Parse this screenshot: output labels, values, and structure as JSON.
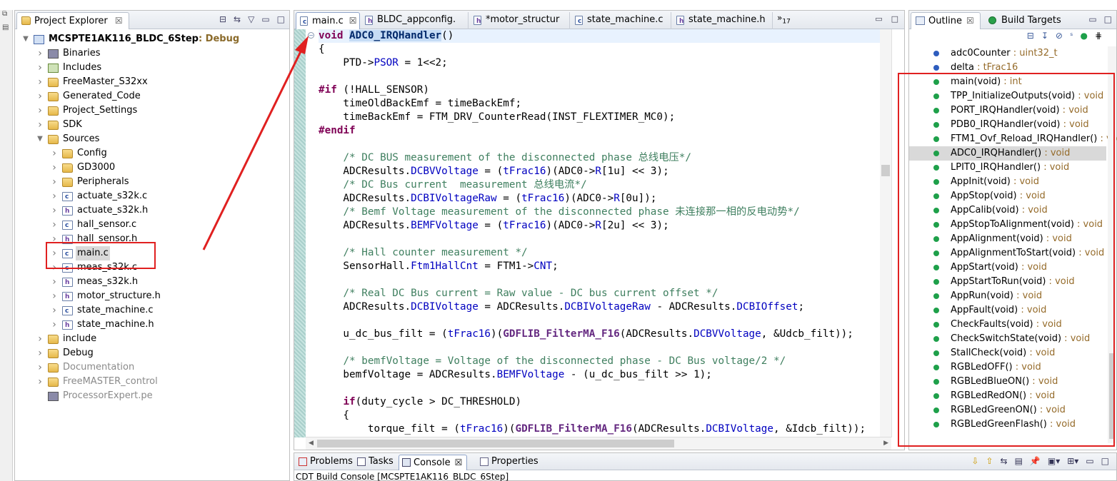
{
  "project_explorer": {
    "tab_label": "Project Explorer",
    "close_glyph": "☒",
    "project": {
      "name": "MCSPTE1AK116_BLDC_6Step",
      "config": ": Debug"
    },
    "items": [
      {
        "label": "Binaries"
      },
      {
        "label": "Includes"
      },
      {
        "label": "FreeMaster_S32xx"
      },
      {
        "label": "Generated_Code"
      },
      {
        "label": "Project_Settings"
      },
      {
        "label": "SDK"
      },
      {
        "label": "Sources"
      },
      {
        "label": "Config"
      },
      {
        "label": "GD3000"
      },
      {
        "label": "Peripherals"
      },
      {
        "label": "actuate_s32k.c"
      },
      {
        "label": "actuate_s32k.h"
      },
      {
        "label": "hall_sensor.c"
      },
      {
        "label": "hall_sensor.h"
      },
      {
        "label": "main.c"
      },
      {
        "label": "meas_s32k.c"
      },
      {
        "label": "meas_s32k.h"
      },
      {
        "label": "motor_structure.h"
      },
      {
        "label": "state_machine.c"
      },
      {
        "label": "state_machine.h"
      },
      {
        "label": "include"
      },
      {
        "label": "Debug"
      },
      {
        "label": "Documentation"
      },
      {
        "label": "FreeMASTER_control"
      },
      {
        "label": "ProcessorExpert.pe"
      }
    ]
  },
  "editor": {
    "tabs": [
      {
        "label": "main.c"
      },
      {
        "label": "BLDC_appconfig."
      },
      {
        "label": "*motor_structur"
      },
      {
        "label": "state_machine.c"
      },
      {
        "label": "state_machine.h"
      }
    ],
    "overflow": "»",
    "overflow_count": "17",
    "code_lines": [
      {
        "t": "void ADC0_IRQHandler()"
      },
      {
        "t": "{"
      },
      {
        "t": "    PTD->PSOR = 1<<2;"
      },
      {
        "t": ""
      },
      {
        "t": "#if (!HALL_SENSOR)"
      },
      {
        "t": "    timeOldBackEmf = timeBackEmf;"
      },
      {
        "t": "    timeBackEmf = FTM_DRV_CounterRead(INST_FLEXTIMER_MC0);"
      },
      {
        "t": "#endif"
      },
      {
        "t": ""
      },
      {
        "t": "    /* DC BUS measurement of the disconnected phase 总线电压*/"
      },
      {
        "t": "    ADCResults.DCBVVoltage = (tFrac16)(ADC0->R[1u] << 3);"
      },
      {
        "t": "    /* DC Bus current  measurement 总线电流*/"
      },
      {
        "t": "    ADCResults.DCBIVoltageRaw = (tFrac16)(ADC0->R[0u]);"
      },
      {
        "t": "    /* Bemf Voltage measurement of the disconnected phase 未连接那一相的反电动势*/"
      },
      {
        "t": "    ADCResults.BEMFVoltage = (tFrac16)(ADC0->R[2u] << 3);"
      },
      {
        "t": ""
      },
      {
        "t": "    /* Hall counter measurement */"
      },
      {
        "t": "    SensorHall.Ftm1HallCnt = FTM1->CNT;"
      },
      {
        "t": ""
      },
      {
        "t": "    /* Real DC Bus current = Raw value - DC bus current offset */"
      },
      {
        "t": "    ADCResults.DCBIVoltage = ADCResults.DCBIVoltageRaw - ADCResults.DCBIOffset;"
      },
      {
        "t": ""
      },
      {
        "t": "    u_dc_bus_filt = (tFrac16)(GDFLIB_FilterMA_F16(ADCResults.DCBVVoltage, &Udcb_filt));"
      },
      {
        "t": ""
      },
      {
        "t": "    /* bemfVoltage = Voltage of the disconnected phase - DC Bus voltage/2 */"
      },
      {
        "t": "    bemfVoltage = ADCResults.BEMFVoltage - (u_dc_bus_filt >> 1);"
      },
      {
        "t": ""
      },
      {
        "t": "    if(duty_cycle > DC_THRESHOLD)"
      },
      {
        "t": "    {"
      },
      {
        "t": "        torque_filt = (tFrac16)(GDFLIB_FilterMA_F16(ADCResults.DCBIVoltage, &Idcb_filt));"
      }
    ]
  },
  "outline": {
    "tabs": [
      {
        "label": "Outline"
      },
      {
        "label": "Build Targets"
      }
    ],
    "items": [
      {
        "name": "adc0Counter",
        "type": " : uint32_t"
      },
      {
        "name": "delta",
        "type": " : tFrac16"
      },
      {
        "name": "main(void)",
        "type": " : int"
      },
      {
        "name": "TPP_InitializeOutputs(void)",
        "type": " : void"
      },
      {
        "name": "PORT_IRQHandler(void)",
        "type": " : void"
      },
      {
        "name": "PDB0_IRQHandler(void)",
        "type": " : void"
      },
      {
        "name": "FTM1_Ovf_Reload_IRQHandler()",
        "type": " : void"
      },
      {
        "name": "ADC0_IRQHandler()",
        "type": " : void"
      },
      {
        "name": "LPIT0_IRQHandler()",
        "type": " : void"
      },
      {
        "name": "AppInit(void)",
        "type": " : void"
      },
      {
        "name": "AppStop(void)",
        "type": " : void"
      },
      {
        "name": "AppCalib(void)",
        "type": " : void"
      },
      {
        "name": "AppStopToAlignment(void)",
        "type": " : void"
      },
      {
        "name": "AppAlignment(void)",
        "type": " : void"
      },
      {
        "name": "AppAlignmentToStart(void)",
        "type": " : void"
      },
      {
        "name": "AppStart(void)",
        "type": " : void"
      },
      {
        "name": "AppStartToRun(void)",
        "type": " : void"
      },
      {
        "name": "AppRun(void)",
        "type": " : void"
      },
      {
        "name": "AppFault(void)",
        "type": " : void"
      },
      {
        "name": "CheckFaults(void)",
        "type": " : void"
      },
      {
        "name": "CheckSwitchState(void)",
        "type": " : void"
      },
      {
        "name": "StallCheck(void)",
        "type": " : void"
      },
      {
        "name": "RGBLedOFF()",
        "type": " : void"
      },
      {
        "name": "RGBLedBlueON()",
        "type": " : void"
      },
      {
        "name": "RGBLedRedON()",
        "type": " : void"
      },
      {
        "name": "RGBLedGreenON()",
        "type": " : void"
      },
      {
        "name": "RGBLedGreenFlash()",
        "type": " : void"
      }
    ]
  },
  "bottom_panel": {
    "tabs": [
      {
        "label": "Problems"
      },
      {
        "label": "Tasks"
      },
      {
        "label": "Console"
      },
      {
        "label": "Properties"
      }
    ],
    "console_title": "CDT Build Console [MCSPTE1AK116_BLDC_6Step]"
  },
  "colors": {
    "annotation": "#e02020",
    "keyword": "#7f0055",
    "field": "#0000c0",
    "comment": "#3f7f5f"
  }
}
